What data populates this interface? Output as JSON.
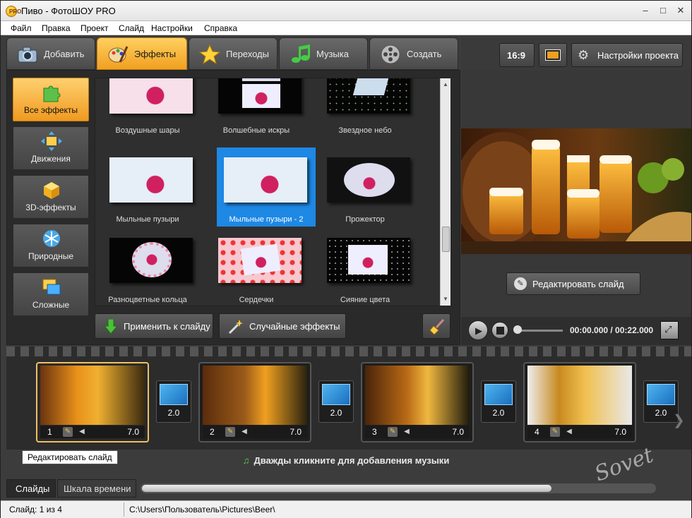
{
  "window": {
    "title": "Пиво - ФотоШОУ PRO",
    "icon_text": "PRO"
  },
  "menu": [
    "Файл",
    "Правка",
    "Проект",
    "Слайд",
    "Настройки",
    "Справка"
  ],
  "tabs": [
    {
      "label": "Добавить",
      "icon": "camera-icon"
    },
    {
      "label": "Эффекты",
      "icon": "palette-icon"
    },
    {
      "label": "Переходы",
      "icon": "star-icon"
    },
    {
      "label": "Музыка",
      "icon": "music-note-icon"
    },
    {
      "label": "Создать",
      "icon": "film-reel-icon"
    }
  ],
  "categories": [
    {
      "label": "Все эффекты",
      "icon": "puzzle-icon"
    },
    {
      "label": "Движения",
      "icon": "move-arrows-icon"
    },
    {
      "label": "3D-эффекты",
      "icon": "cube-icon"
    },
    {
      "label": "Природные",
      "icon": "snowflake-icon"
    },
    {
      "label": "Сложные",
      "icon": "layers-icon"
    }
  ],
  "effects": [
    {
      "label": "Воздушные шары"
    },
    {
      "label": "Волшебные искры"
    },
    {
      "label": "Звездное небо"
    },
    {
      "label": "Мыльные пузыри"
    },
    {
      "label": "Мыльные пузыри - 2"
    },
    {
      "label": "Прожектор"
    },
    {
      "label": "Разноцветные кольца"
    },
    {
      "label": "Сердечки"
    },
    {
      "label": "Сияние цвета"
    }
  ],
  "actions": {
    "apply": "Применить к слайду",
    "random": "Случайные эффекты"
  },
  "right": {
    "ratio": "16:9",
    "settings": "Настройки проекта",
    "edit_slide": "Редактировать слайд"
  },
  "player": {
    "time": "00:00.000 / 00:22.000"
  },
  "slides": [
    {
      "num": "1",
      "dur": "7.0"
    },
    {
      "num": "2",
      "dur": "7.0"
    },
    {
      "num": "3",
      "dur": "7.0"
    },
    {
      "num": "4",
      "dur": "7.0"
    }
  ],
  "transitions": [
    "2.0",
    "2.0",
    "2.0",
    "2.0"
  ],
  "tooltip": "Редактировать слайд",
  "music_hint": "Дважды кликните для добавления музыки",
  "bottom_tabs": [
    "Слайды",
    "Шкала времени"
  ],
  "status": {
    "slide": "Слайд: 1 из 4",
    "path": "C:\\Users\\Пользователь\\Pictures\\Beer\\"
  },
  "watermark": "Sovet",
  "colors": {
    "accent": "#f0a020",
    "selection": "#1e88e5"
  }
}
